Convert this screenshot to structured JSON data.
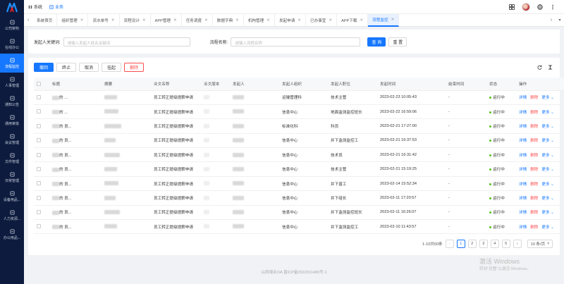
{
  "colors": {
    "sidebar": "#0d1b3e",
    "accent": "#1677ff",
    "danger": "#ff4d4f",
    "success": "#52c41a"
  },
  "sidebar": {
    "items": [
      {
        "label": "公司架构",
        "icon": "org-icon"
      },
      {
        "label": "在线办公",
        "icon": "monitor-icon"
      },
      {
        "label": "流程监控",
        "icon": "monitor-flow-icon",
        "active": true
      },
      {
        "label": "人事管理",
        "icon": "person-icon"
      },
      {
        "label": "通知公告",
        "icon": "bell-icon"
      },
      {
        "label": "通用审批",
        "icon": "approve-icon"
      },
      {
        "label": "会议管理",
        "icon": "meeting-icon"
      },
      {
        "label": "文件管理",
        "icon": "folder-icon"
      },
      {
        "label": "日常管理",
        "icon": "calendar-icon"
      },
      {
        "label": "设备用品...",
        "icon": "device-icon"
      },
      {
        "label": "人力资源...",
        "icon": "hr-icon"
      },
      {
        "label": "办公用品...",
        "icon": "supplies-icon"
      }
    ]
  },
  "topbar": {
    "system_label": "系统",
    "business_label": "业务"
  },
  "tabs": [
    {
      "label": "系统首页",
      "closable": false
    },
    {
      "label": "组织管理",
      "closable": true
    },
    {
      "label": "流水单号",
      "closable": true
    },
    {
      "label": "流程设计",
      "closable": true
    },
    {
      "label": "APP管理",
      "closable": true
    },
    {
      "label": "任务调度",
      "closable": true
    },
    {
      "label": "数据字典",
      "closable": true
    },
    {
      "label": "机构管理",
      "closable": true
    },
    {
      "label": "发起申请",
      "closable": true
    },
    {
      "label": "已办事宜",
      "closable": true
    },
    {
      "label": "APP下载",
      "closable": true
    },
    {
      "label": "流程监控",
      "closable": true,
      "active": true
    }
  ],
  "search": {
    "initiator_label": "发起人关键词:",
    "initiator_placeholder": "请输入发起人姓名关键词",
    "process_label": "流程名称:",
    "process_placeholder": "请输入流程名称",
    "query_button": "查 询",
    "reset_button": "重 置"
  },
  "toolbar": {
    "resume": "撤回",
    "stop": "终止",
    "cancel": "取消",
    "pending": "挂起",
    "delete": "删除"
  },
  "table": {
    "columns": [
      "标题",
      "摘要",
      "业文名称",
      "业文版本",
      "发起人",
      "发起人组织",
      "发起人职位",
      "发起时间",
      "结束时间",
      "状态",
      "操作"
    ],
    "rows": [
      {
        "title": "的 ...",
        "summary": "",
        "name": "员工转正提级提薪申请",
        "version": "",
        "initiator": "",
        "org": "运输管理科",
        "position": "技术主管",
        "start": "2023-02-23 10:05:43",
        "end": "-",
        "status": "运行中"
      },
      {
        "title": "的 ...",
        "summary": "",
        "name": "员工转正提级提薪申请",
        "version": "",
        "initiator": "",
        "org": "信息中心",
        "position": "地面监测监控班长",
        "start": "2023-02-22 16:59:06",
        "end": "-",
        "status": "运行中"
      },
      {
        "title": "的 员...",
        "summary": "",
        "name": "员工转正提级提薪申请",
        "version": "",
        "initiator": "",
        "org": "标准化科",
        "position": "科员",
        "start": "2023-02-21 17:27:00",
        "end": "-",
        "status": "运行中"
      },
      {
        "title": "的 员...",
        "summary": "",
        "name": "员工转正提级提薪申请",
        "version": "",
        "initiator": "",
        "org": "信息中心",
        "position": "井下监测监控工",
        "start": "2023-02-21 16:37:53",
        "end": "-",
        "status": "运行中"
      },
      {
        "title": "的 员...",
        "summary": "",
        "name": "员工转正提级提薪申请",
        "version": "",
        "initiator": "",
        "org": "信息中心",
        "position": "技术员",
        "start": "2023-02-21 16:31:42",
        "end": "-",
        "status": "运行中"
      },
      {
        "title": "的 员...",
        "summary": "",
        "name": "员工转正提级提薪申请",
        "version": "",
        "initiator": "",
        "org": "信息中心",
        "position": "技术主管",
        "start": "2023-02-21 15:19:25",
        "end": "-",
        "status": "运行中"
      },
      {
        "title": "的 员...",
        "summary": "",
        "name": "员工转正提级提薪申请",
        "version": "",
        "initiator": "",
        "org": "信息中心",
        "position": "井下普工",
        "start": "2023-02-14 15:52:34",
        "end": "-",
        "status": "运行中"
      },
      {
        "title": "的 员...",
        "summary": "",
        "name": "员工转正提级提薪申请",
        "version": "",
        "initiator": "",
        "org": "信息中心",
        "position": "井下组长",
        "start": "2023-02-11 17:20:57",
        "end": "-",
        "status": "运行中"
      },
      {
        "title": "的 员...",
        "summary": "",
        "name": "员工转正提级提薪申请",
        "version": "",
        "initiator": "",
        "org": "信息中心",
        "position": "井下监测监控班长",
        "start": "2023-02-11 16:26:07",
        "end": "-",
        "status": "运行中"
      },
      {
        "title": "的 员...",
        "summary": "",
        "name": "员工转正提级提薪申请",
        "version": "",
        "initiator": "",
        "org": "信息中心",
        "position": "井下监测监控工",
        "start": "2023-02-10 11:43:57",
        "end": "-",
        "status": "运行中"
      }
    ],
    "op_detail": "详情",
    "op_delete": "删除",
    "op_more": "更多"
  },
  "pagination": {
    "range": "1-10共50条",
    "pages": [
      "1",
      "2",
      "3",
      "4",
      "5"
    ],
    "current": "1",
    "size": "10 条/页"
  },
  "footer": "山西煤业OA 晋ICP备2022011490号-1",
  "watermark": {
    "line1": "激活 Windows",
    "line2": "转到\"设置\"以激活 Windows。"
  }
}
